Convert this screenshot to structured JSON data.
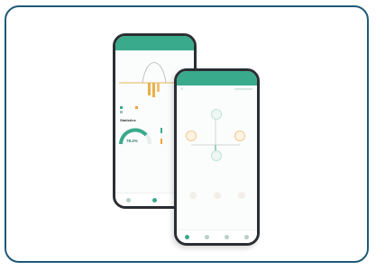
{
  "back_phone": {
    "toolbar_left": "",
    "toolbar_right": "",
    "chart_label": "",
    "stats_title": "Statistics",
    "gauge_value": "78.2%",
    "legend": [
      "",
      "",
      "",
      ""
    ],
    "side_values": [
      "",
      ""
    ]
  },
  "front_phone": {
    "toolbar_left": "",
    "toolbar_right": "",
    "top_label": "",
    "top_value": "",
    "left_value": "",
    "right_value": "",
    "bottom_values": [
      "",
      "",
      ""
    ]
  },
  "colors": {
    "accent": "#3aaa8c",
    "border": "#1f5a78",
    "solar": "#f0a23a",
    "bar": "#e8b04a"
  }
}
